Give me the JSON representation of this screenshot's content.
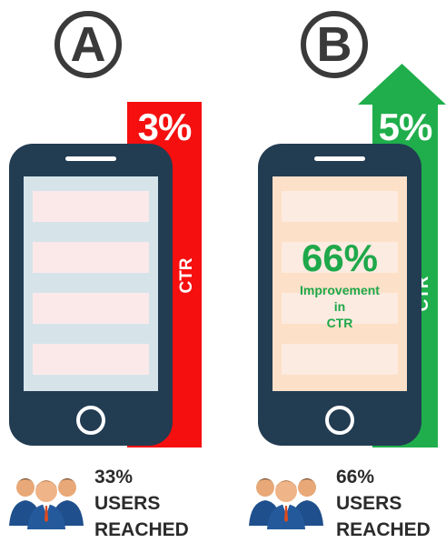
{
  "variant_a": {
    "letter": "A",
    "ctr_value": "3%",
    "ctr_label": "CTR",
    "bar_color": "#f50f0f",
    "users_pct": "33%",
    "users_line2": "USERS",
    "users_line3": "REACHED"
  },
  "variant_b": {
    "letter": "B",
    "ctr_value": "5%",
    "ctr_label": "CTR",
    "bar_color": "#1fae4b",
    "users_pct": "66%",
    "users_line2": "USERS",
    "users_line3": "REACHED",
    "improvement_value": "66%",
    "improvement_line1": "Improvement",
    "improvement_line2": "in",
    "improvement_line3": "CTR"
  },
  "colors": {
    "phone_body": "#223c52",
    "screen_a": "#d6e4ea",
    "screen_b": "#fde0c8",
    "accent_green": "#1ea84a",
    "accent_red": "#f50f0f"
  },
  "icons": [
    "users-group-icon",
    "arrow-up-icon",
    "home-button-icon"
  ]
}
